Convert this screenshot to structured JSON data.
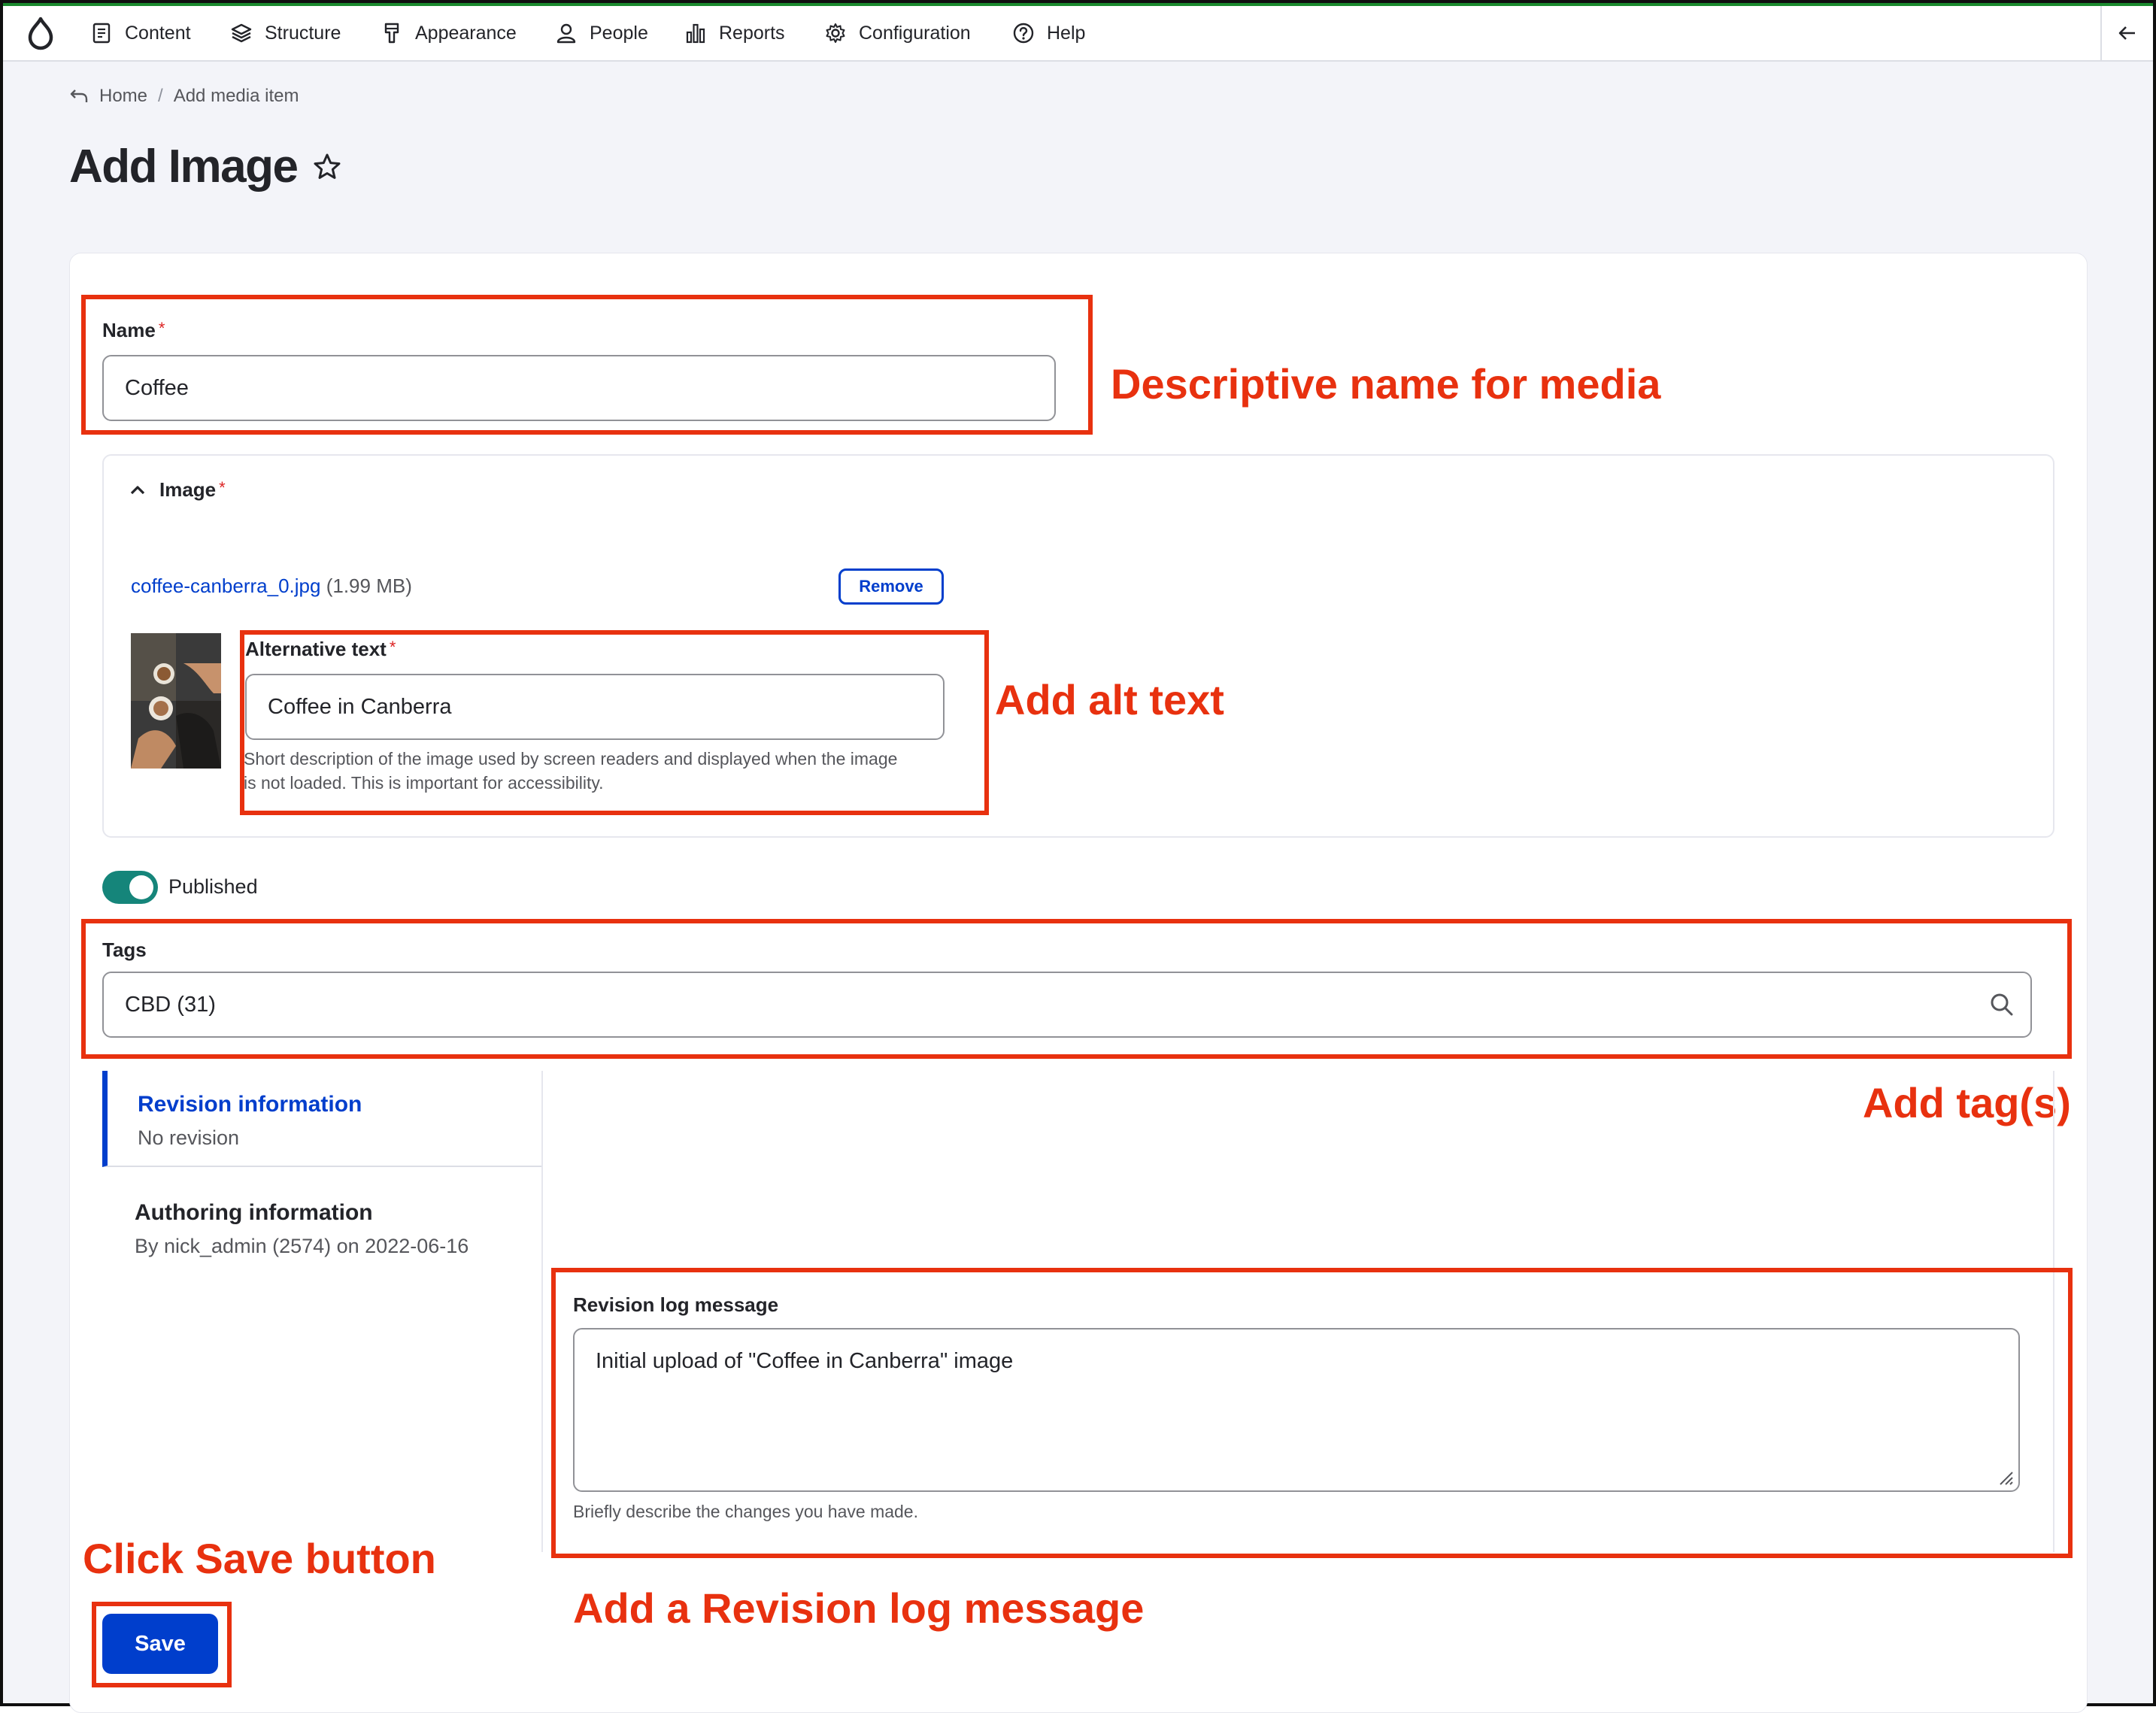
{
  "toolbar": {
    "items": [
      {
        "label": "Content",
        "icon": "document-icon"
      },
      {
        "label": "Structure",
        "icon": "layers-icon"
      },
      {
        "label": "Appearance",
        "icon": "paint-brush-icon"
      },
      {
        "label": "People",
        "icon": "person-icon"
      },
      {
        "label": "Reports",
        "icon": "bar-chart-icon"
      },
      {
        "label": "Configuration",
        "icon": "gear-icon"
      },
      {
        "label": "Help",
        "icon": "help-icon"
      }
    ]
  },
  "breadcrumb": {
    "home": "Home",
    "current": "Add media item"
  },
  "page": {
    "title": "Add Image"
  },
  "form": {
    "name_label": "Name",
    "name_value": "Coffee",
    "image_label": "Image",
    "file_name": "coffee-canberra_0.jpg",
    "file_size": "(1.99 MB)",
    "remove_label": "Remove",
    "alt_label": "Alternative text",
    "alt_value": "Coffee in Canberra",
    "alt_desc_1": "Short description of the image used by screen readers and displayed when the image",
    "alt_desc_2": "is not loaded. This is important for accessibility.",
    "published_label": "Published",
    "published": true,
    "tags_label": "Tags",
    "tags_value": "CBD (31)",
    "revision_tab_title": "Revision information",
    "revision_tab_sub": "No revision",
    "authoring_tab_title": "Authoring information",
    "authoring_tab_sub": "By nick_admin (2574) on 2022-06-16",
    "revision_log_label": "Revision log message",
    "revision_log_value": "Initial upload of \"Coffee in Canberra\" image",
    "revision_log_desc": "Briefly describe the changes you have made.",
    "save_label": "Save"
  },
  "annotations": {
    "name": "Descriptive name for media",
    "alt": "Add alt text",
    "tags": "Add tag(s)",
    "save": "Click Save button",
    "revision": "Add a Revision log message"
  },
  "colors": {
    "accent": "#003ecc",
    "annotation": "#e8310f",
    "toggle_on": "#15857a"
  }
}
